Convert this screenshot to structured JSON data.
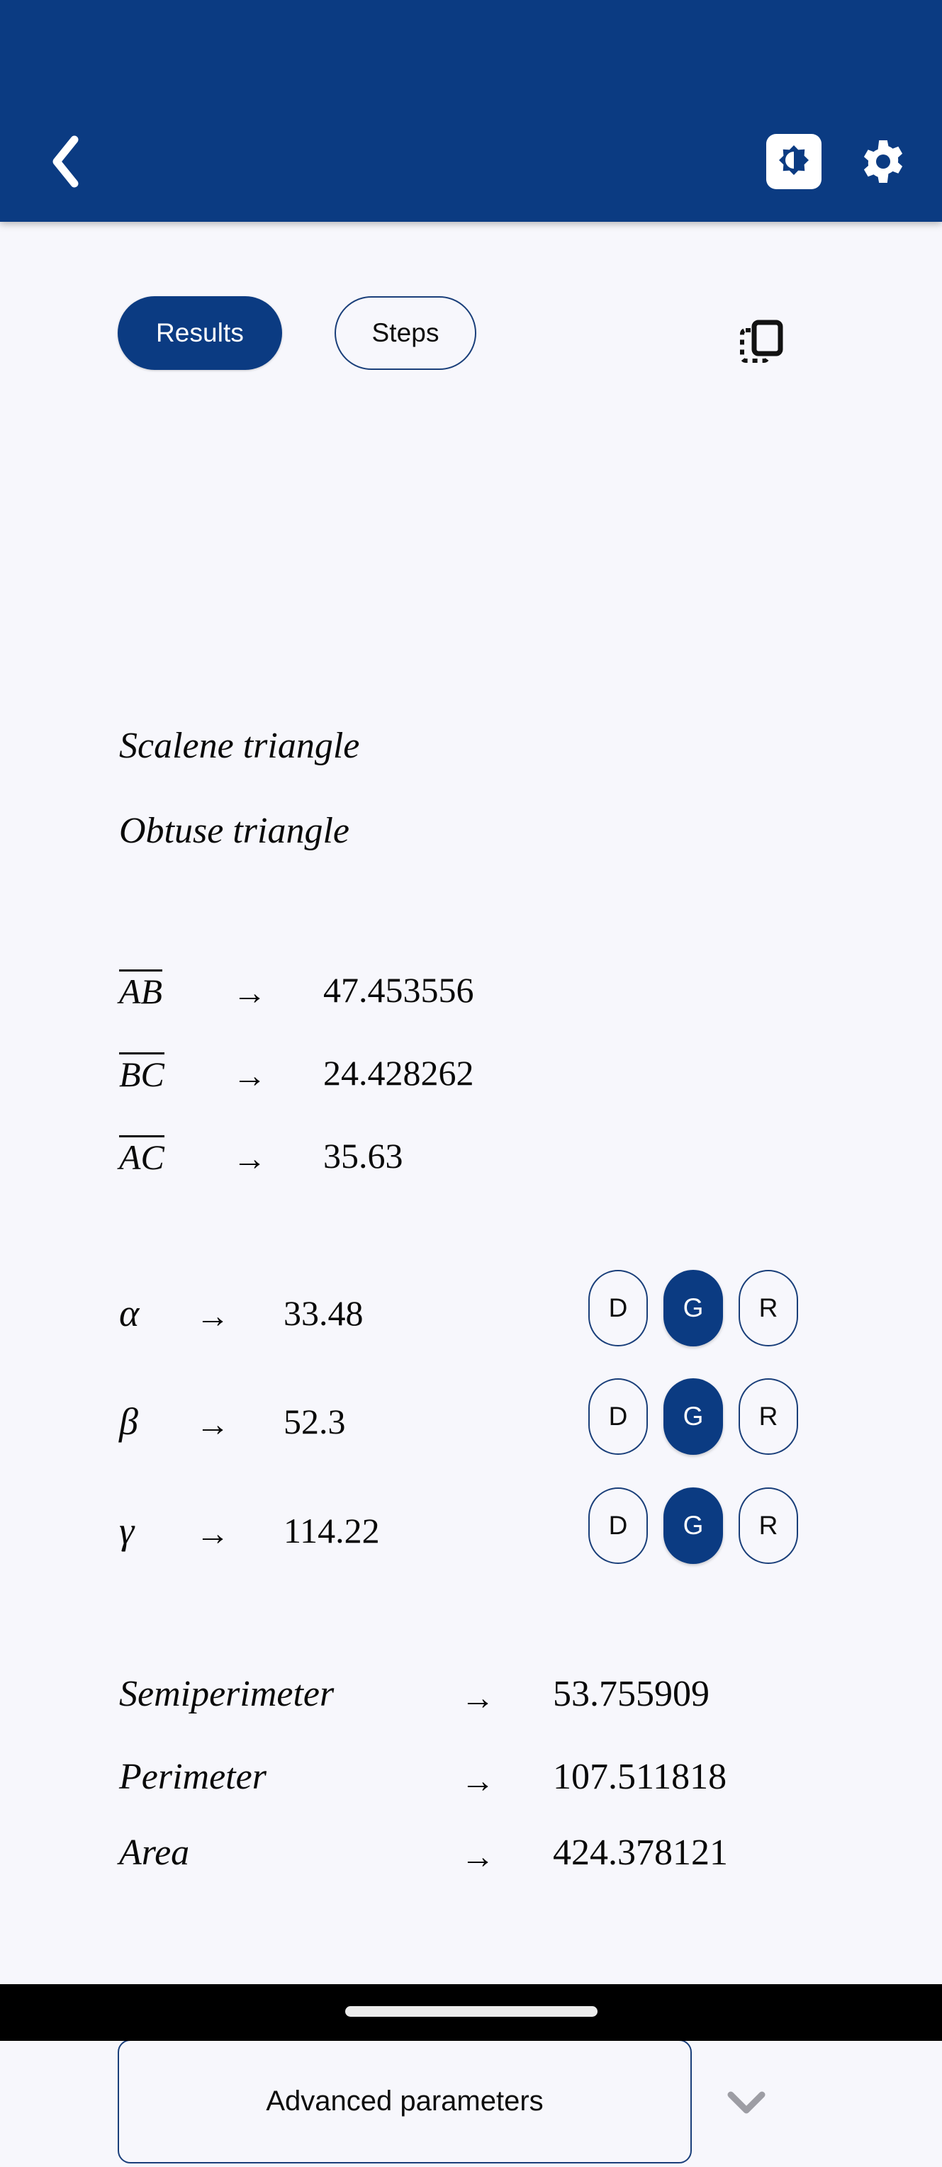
{
  "header": {
    "back_icon": "chevron-left-icon",
    "theme_toggle_icon": "brightness-half-icon",
    "settings_icon": "gear-icon",
    "bg_color": "#0b3b82"
  },
  "tabs": {
    "copy_icon": "copy-icon",
    "items": [
      {
        "label": "Results",
        "active": true
      },
      {
        "label": "Steps",
        "active": false
      }
    ]
  },
  "classification": [
    "Scalene triangle",
    "Obtuse triangle"
  ],
  "sides": {
    "arrow": "→",
    "rows": [
      {
        "label": "AB",
        "value": "47.453556"
      },
      {
        "label": "BC",
        "value": "24.428262"
      },
      {
        "label": "AC",
        "value": "35.63"
      }
    ]
  },
  "angles": {
    "arrow": "→",
    "unit_options": [
      "D",
      "G",
      "R"
    ],
    "rows": [
      {
        "label": "α",
        "value": "33.48",
        "unit": "G"
      },
      {
        "label": "β",
        "value": "52.3",
        "unit": "G"
      },
      {
        "label": "γ",
        "value": "114.22",
        "unit": "G"
      }
    ]
  },
  "metrics": {
    "arrow": "→",
    "rows": [
      {
        "label": "Semiperimeter",
        "value": "53.755909"
      },
      {
        "label": "Perimeter",
        "value": "107.511818"
      },
      {
        "label": "Area",
        "value": "424.378121"
      }
    ]
  },
  "advanced": {
    "label": "Advanced parameters",
    "chevron_icon": "chevron-down-icon"
  },
  "colors": {
    "primary": "#0b3b82",
    "background": "#f7f7fc",
    "outline": "#1a3f7a",
    "text": "#0a0a0a"
  }
}
